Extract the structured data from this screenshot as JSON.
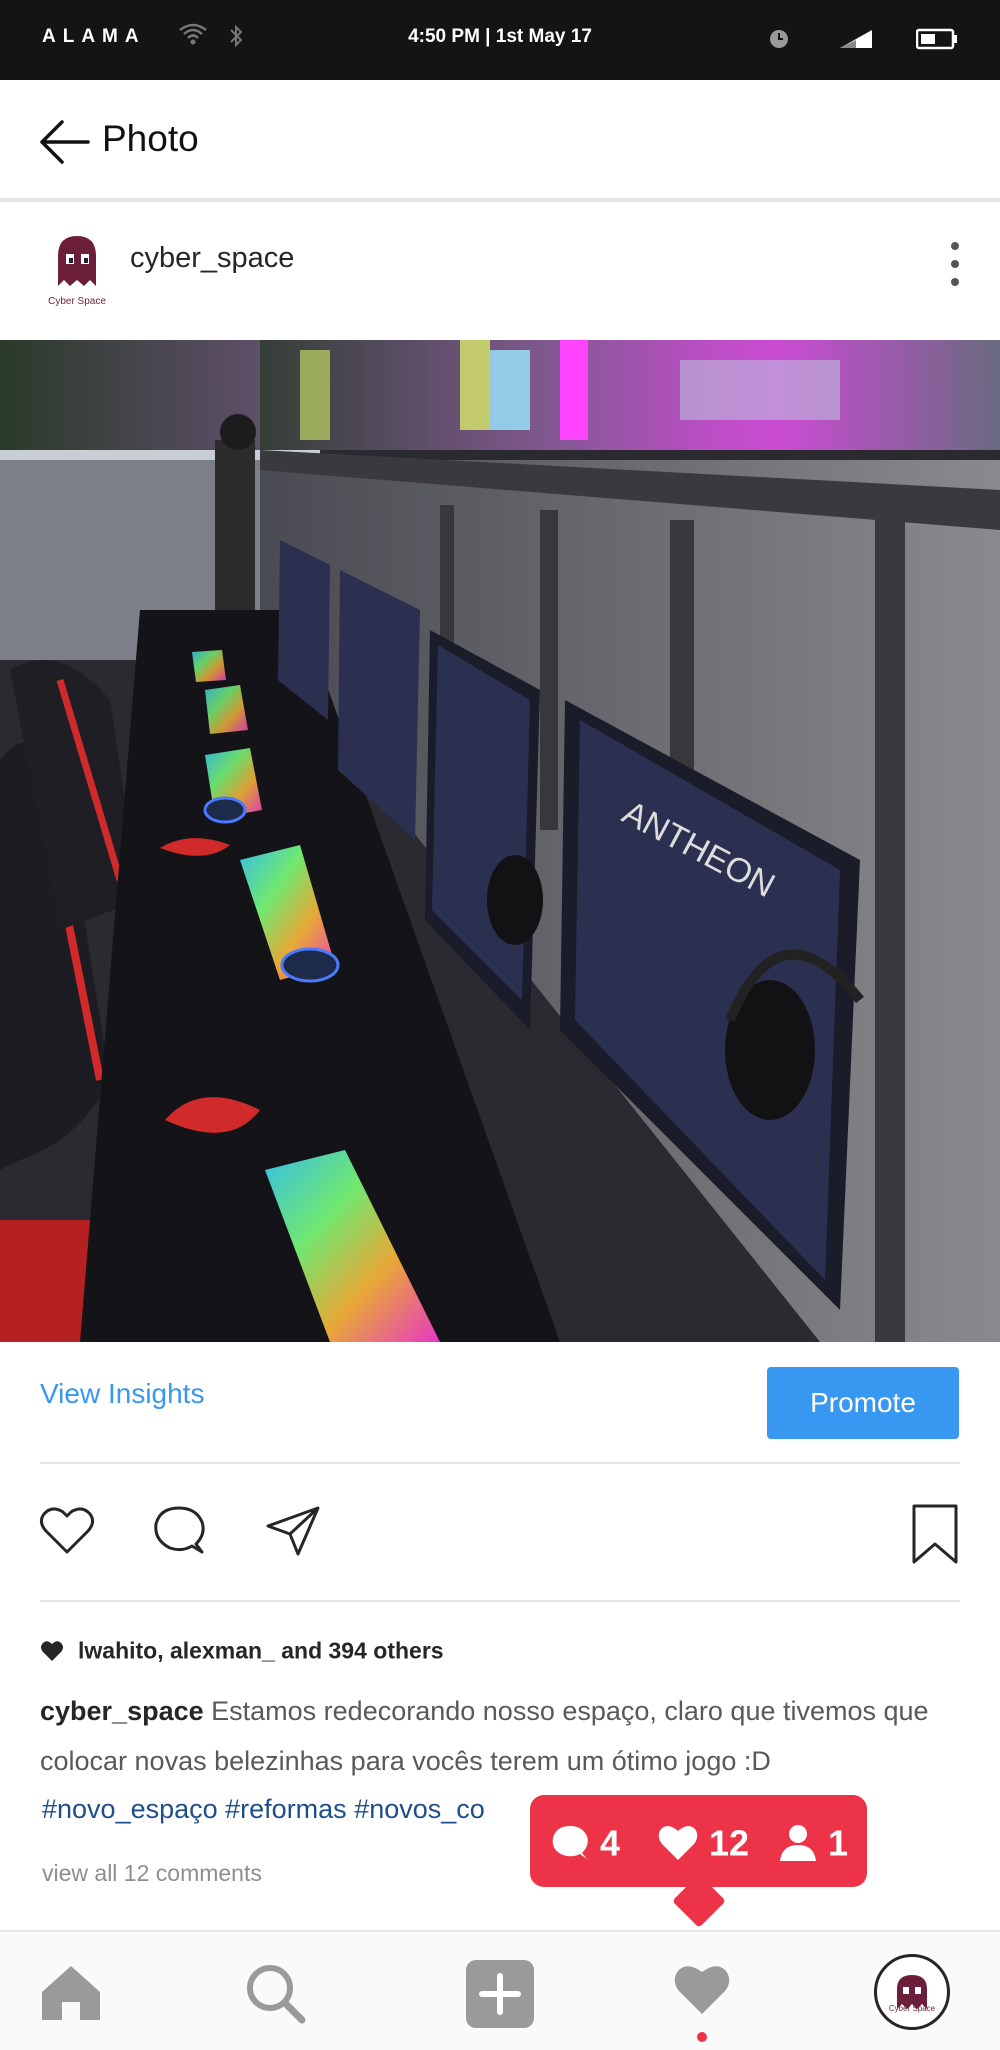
{
  "status_bar": {
    "carrier": "ALAMA",
    "time": "4:50 PM | 1st May 17",
    "icons": [
      "wifi-icon",
      "bluetooth-icon",
      "clock-icon",
      "signal-icon",
      "battery-icon"
    ]
  },
  "header": {
    "title": "Photo",
    "back_icon": "arrow-left-icon"
  },
  "post": {
    "username": "cyber_space",
    "avatar_label": "Cyber Space",
    "more_icon": "vertical-dots-icon",
    "photo_description_icon": "gaming-room-photo",
    "view_insights": "View Insights",
    "promote": "Promote",
    "action_icons": [
      "heart-outline-icon",
      "comment-icon",
      "share-icon",
      "bookmark-icon"
    ],
    "likes_text": "lwahito, alexman_ and 394 others",
    "caption_user": "cyber_space",
    "caption_text": "Estamos redecorando nosso espaço, claro que tivemos que colocar novas belezinhas para vocês terem um ótimo jogo :D",
    "hashtags": "#novo_espaço #reformas #novos_co",
    "view_all_comments": "view all 12 comments"
  },
  "activity_popup": {
    "comments": "4",
    "likes": "12",
    "followers": "1"
  },
  "tab_bar": {
    "items": [
      "home-icon",
      "search-icon",
      "add-post-icon",
      "activity-heart-icon",
      "profile-avatar"
    ],
    "profile_label": "Cyber Space"
  },
  "colors": {
    "accent": "#3897f0",
    "notification": "#ed3347",
    "hashtag": "#1f4f8a"
  }
}
